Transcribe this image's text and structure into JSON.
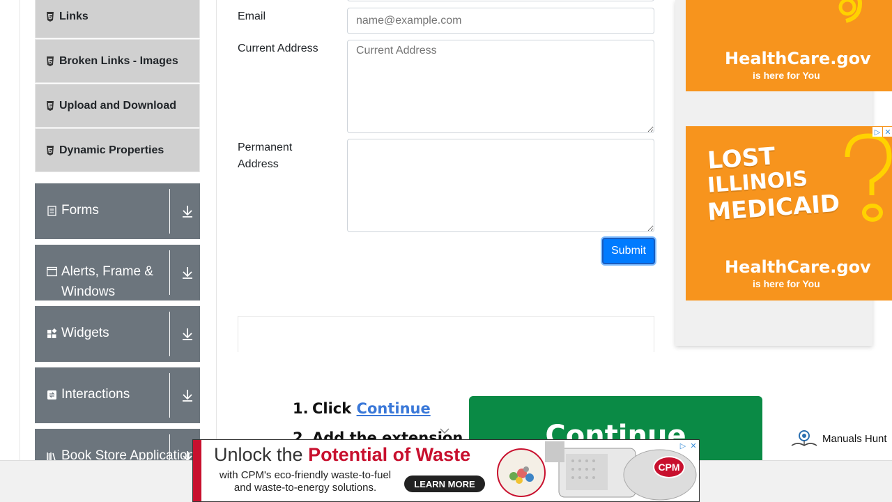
{
  "sidebar": {
    "sub_items": [
      {
        "label": "Links"
      },
      {
        "label": "Broken Links - Images"
      },
      {
        "label": "Upload and Download"
      },
      {
        "label": "Dynamic Properties"
      }
    ],
    "groups": [
      {
        "label": "Forms",
        "icon": "document-icon"
      },
      {
        "label": "Alerts, Frame & Windows",
        "icon": "window-icon"
      },
      {
        "label": "Widgets",
        "icon": "widgets-icon"
      },
      {
        "label": "Interactions",
        "icon": "interactions-icon"
      },
      {
        "label": "Book Store Application",
        "icon": "books-icon"
      }
    ]
  },
  "form": {
    "email_label": "Email",
    "email_placeholder": "name@example.com",
    "current_address_label": "Current Address",
    "current_address_placeholder": "Current Address",
    "permanent_address_label": "Permanent Address",
    "submit_label": "Submit"
  },
  "steps_ad": {
    "step1_num": "1.",
    "step1_text": "Click ",
    "step1_link": "Continue",
    "step2_num": "2.",
    "step2_text": "Add the extension",
    "button_label": "Continue",
    "manuals": "Manuals Hunt"
  },
  "right_ads": {
    "ad1_brand": "HealthCare.gov",
    "ad1_tagline": "is here for You",
    "ad2_headline": [
      "LOST",
      "ILLINOIS",
      "MEDICAID"
    ],
    "ad2_brand": "HealthCare.gov",
    "ad2_tagline": "is here for You"
  },
  "bottom_banner": {
    "headline_plain": "Unlock the ",
    "headline_emph": "Potential of Waste",
    "subtext": "with CPM's eco-friendly waste-to-fuel and waste-to-energy solutions.",
    "cta": "LEARN MORE",
    "brand": "CPM"
  },
  "colors": {
    "sidebar_group_bg": "#6c757d",
    "sidebar_item_bg": "#d0d0d0",
    "submit_bg": "#007bff",
    "ad_orange": "#f7941d",
    "continue_green": "#0a8a45",
    "cpm_red": "#c8102e"
  }
}
